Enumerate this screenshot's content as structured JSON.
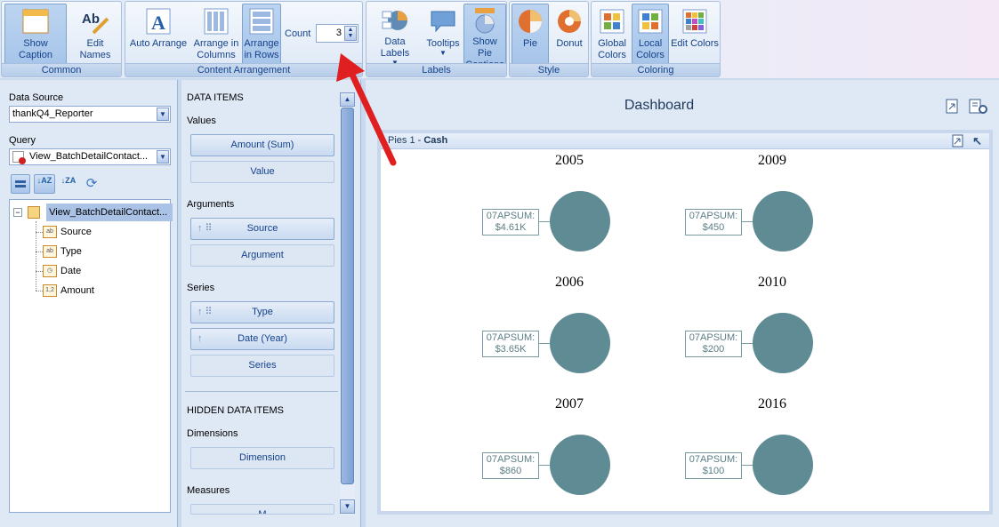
{
  "ribbon": {
    "common": {
      "caption": "Common",
      "show_caption": "Show Caption",
      "edit_names": "Edit Names"
    },
    "content": {
      "caption": "Content Arrangement",
      "auto_arrange": "Auto Arrange",
      "arrange_columns": "Arrange in Columns",
      "arrange_rows": "Arrange in Rows",
      "count_label": "Count",
      "count_value": "3"
    },
    "labels": {
      "caption": "Labels",
      "data_labels": "Data Labels",
      "tooltips": "Tooltips",
      "show_pie_captions": "Show Pie Captions"
    },
    "style": {
      "caption": "Style",
      "pie": "Pie",
      "donut": "Donut"
    },
    "coloring": {
      "caption": "Coloring",
      "global_colors": "Global Colors",
      "local_colors": "Local Colors",
      "edit_colors": "Edit Colors"
    }
  },
  "left": {
    "data_source_label": "Data Source",
    "data_source_value": "thankQ4_Reporter",
    "query_label": "Query",
    "query_value": "View_BatchDetailContact...",
    "tree_root": "View_BatchDetailContact...",
    "fields": [
      {
        "name": "Source",
        "type": "ab"
      },
      {
        "name": "Type",
        "type": "ab"
      },
      {
        "name": "Date",
        "type": "clock"
      },
      {
        "name": "Amount",
        "type": "1,2"
      }
    ]
  },
  "mid": {
    "data_items": "DATA ITEMS",
    "values_label": "Values",
    "values": [
      "Amount (Sum)",
      "Value"
    ],
    "arguments_label": "Arguments",
    "arguments": [
      "Source",
      "Argument"
    ],
    "series_label": "Series",
    "series": [
      "Type",
      "Date (Year)",
      "Series"
    ],
    "hidden_label": "HIDDEN DATA ITEMS",
    "dimensions_label": "Dimensions",
    "dimension": "Dimension",
    "measures_label": "Measures",
    "measure_partial": "M"
  },
  "dashboard": {
    "title": "Dashboard",
    "item_prefix": "Pies 1 - ",
    "item_name": "Cash"
  },
  "chart_data": {
    "type": "pie",
    "pies": [
      {
        "year": "2005",
        "label": "07APSUM:",
        "value": "$4.61K"
      },
      {
        "year": "2009",
        "label": "07APSUM:",
        "value": "$450"
      },
      {
        "year": "2006",
        "label": "07APSUM:",
        "value": "$3.65K"
      },
      {
        "year": "2010",
        "label": "07APSUM:",
        "value": "$200"
      },
      {
        "year": "2007",
        "label": "07APSUM:",
        "value": "$860"
      },
      {
        "year": "2016",
        "label": "07APSUM:",
        "value": "$100"
      }
    ],
    "slice_color": "#5f8b94"
  },
  "colors": {
    "accent": "#15428b",
    "arrow": "#e02020"
  }
}
